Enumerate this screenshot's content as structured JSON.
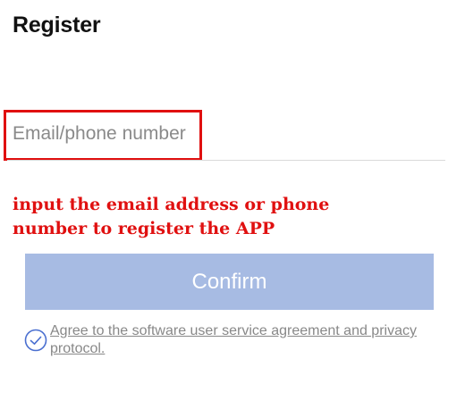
{
  "header": {
    "title": "Register"
  },
  "form": {
    "email_placeholder": "Email/phone number",
    "email_value": ""
  },
  "annotation": {
    "text": "input the email address or phone number to register the APP",
    "color": "#e01010"
  },
  "confirm_button": {
    "label": "Confirm",
    "color": "#a7bbe3"
  },
  "agreement": {
    "text": "Agree to the software user service agreement and privacy protocol.",
    "checkbox_icon": "check-circle-icon",
    "checked": true
  }
}
